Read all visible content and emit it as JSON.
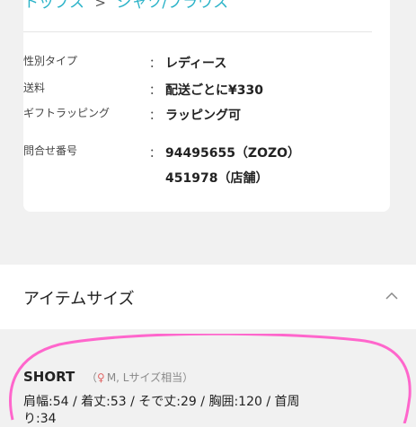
{
  "breadcrumb": {
    "items": [
      "トップス",
      "シャツ/ブラウス"
    ],
    "separator": ">"
  },
  "info": {
    "rows": [
      {
        "label": "性別タイプ",
        "value": "レディース"
      },
      {
        "label": "送料",
        "value": "配送ごとに¥330"
      },
      {
        "label": "ギフトラッピング",
        "value": "ラッピング可"
      },
      {
        "label": "問合せ番号",
        "value": "94495655（ZOZO）"
      },
      {
        "label": "",
        "value": "451978（店舗）"
      }
    ],
    "colon": "："
  },
  "size_section": {
    "title": "アイテムサイズ",
    "size_name": "SHORT",
    "size_note": "M, Lサイズ相当",
    "measurements_line1": "肩幅:54 / 着丈:53 / そで丈:29 / 胸囲:120 / 首周",
    "measurements_line2": "り:34"
  },
  "colors": {
    "accent": "#2bb3c8",
    "annotation": "#ff66cc"
  },
  "icons": {
    "collapse": "chevron-up-icon",
    "person": "person-icon"
  }
}
